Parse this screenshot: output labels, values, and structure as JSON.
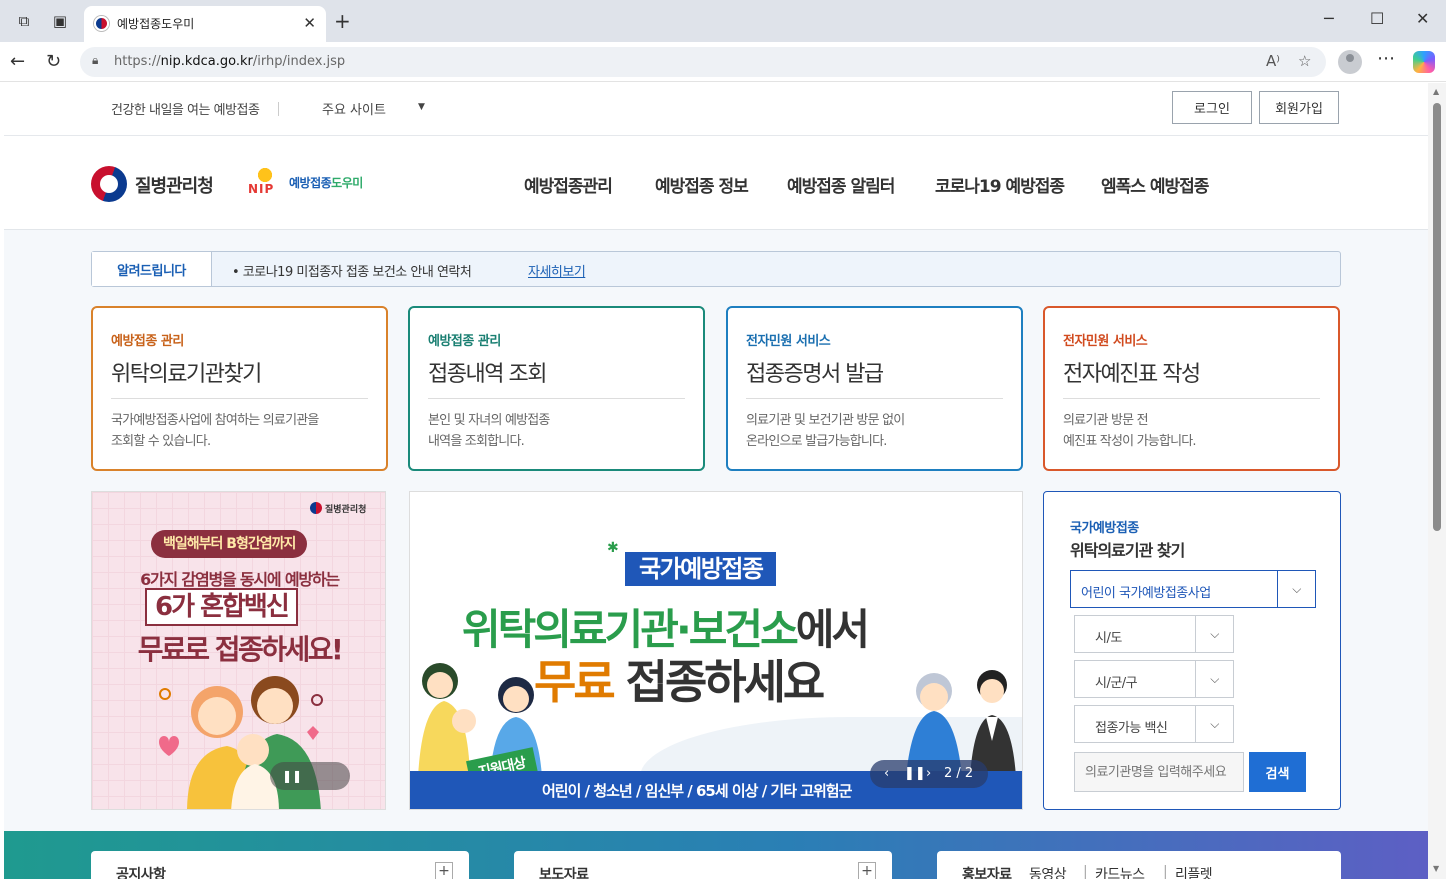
{
  "browser": {
    "tab_title": "예방접종도우미",
    "url_prefix": "https://",
    "url_host": "nip.kdca.go.kr",
    "url_path": "/irhp/index.jsp"
  },
  "util": {
    "slogan": "건강한 내일을 여는 예방접종",
    "sites_label": "주요 사이트",
    "login": "로그인",
    "signup": "회원가입"
  },
  "header": {
    "org_name": "질병관리청",
    "nip_mark": "NIP",
    "nip_name_a": "예방접종",
    "nip_name_b": "도우미",
    "gnb": [
      "예방접종관리",
      "예방접종 정보",
      "예방접종 알림터",
      "코로나19 예방접종",
      "엠폭스 예방접종"
    ]
  },
  "notice": {
    "label": "알려드립니다",
    "text": "•  코로나19 미접종자 접종 보건소 안내 연락처",
    "link": "자세히보기"
  },
  "cards": [
    {
      "category": "예방접종 관리",
      "title": "위탁의료기관찾기",
      "desc1": "국가예방접종사업에 참여하는 의료기관을",
      "desc2": "조회할 수 있습니다.",
      "color": "#d9822b"
    },
    {
      "category": "예방접종 관리",
      "title": "접종내역 조회",
      "desc1": "본인 및 자녀의 예방접종",
      "desc2": "내역을 조회합니다.",
      "color": "#1a8a7a"
    },
    {
      "category": "전자민원 서비스",
      "title": "접종증명서 발급",
      "desc1": "의료기관 및 보건기관 방문 없이",
      "desc2": "온라인으로 발급가능합니다.",
      "color": "#1e7fc0"
    },
    {
      "category": "전자민원 서비스",
      "title": "전자예진표 작성",
      "desc1": "의료기관 방문 전",
      "desc2": "예진표 작성이 가능합니다.",
      "color": "#d9582b"
    }
  ],
  "banner_left": {
    "logo": "질병관리청",
    "line1": "백일해부터 B형간염까지",
    "line2": "6가지 감염병을 동시에 예방하는",
    "line3": "6가 혼합백신",
    "line4": "무료로 접종하세요!"
  },
  "banner_center": {
    "badge": "국가예방접종",
    "line1_a": "위탁의료기관·보건소",
    "line1_b": "에서",
    "line2_a": "무료",
    "line2_b": " 접종하세요",
    "tag": "지원대상",
    "targets": "어린이 / 청소년 / 임신부 / 65세 이상 / 기타 고위험군",
    "pager": "2 / 2"
  },
  "finder": {
    "subtitle": "국가예방접종",
    "title": "위탁의료기관 찾기",
    "program_select": "어린이 국가예방접종사업",
    "sido_select": "시/도",
    "sigungu_select": "시/군/구",
    "vaccine_select": "접종가능 백신",
    "search_placeholder": "의료기관명을 입력해주세요",
    "search_button": "검색"
  },
  "boards": {
    "notice_title": "공지사항",
    "press_title": "보도자료",
    "promo_tabs": [
      "홍보자료",
      "동영상",
      "|",
      "카드뉴스",
      "|",
      "리플렛"
    ]
  }
}
